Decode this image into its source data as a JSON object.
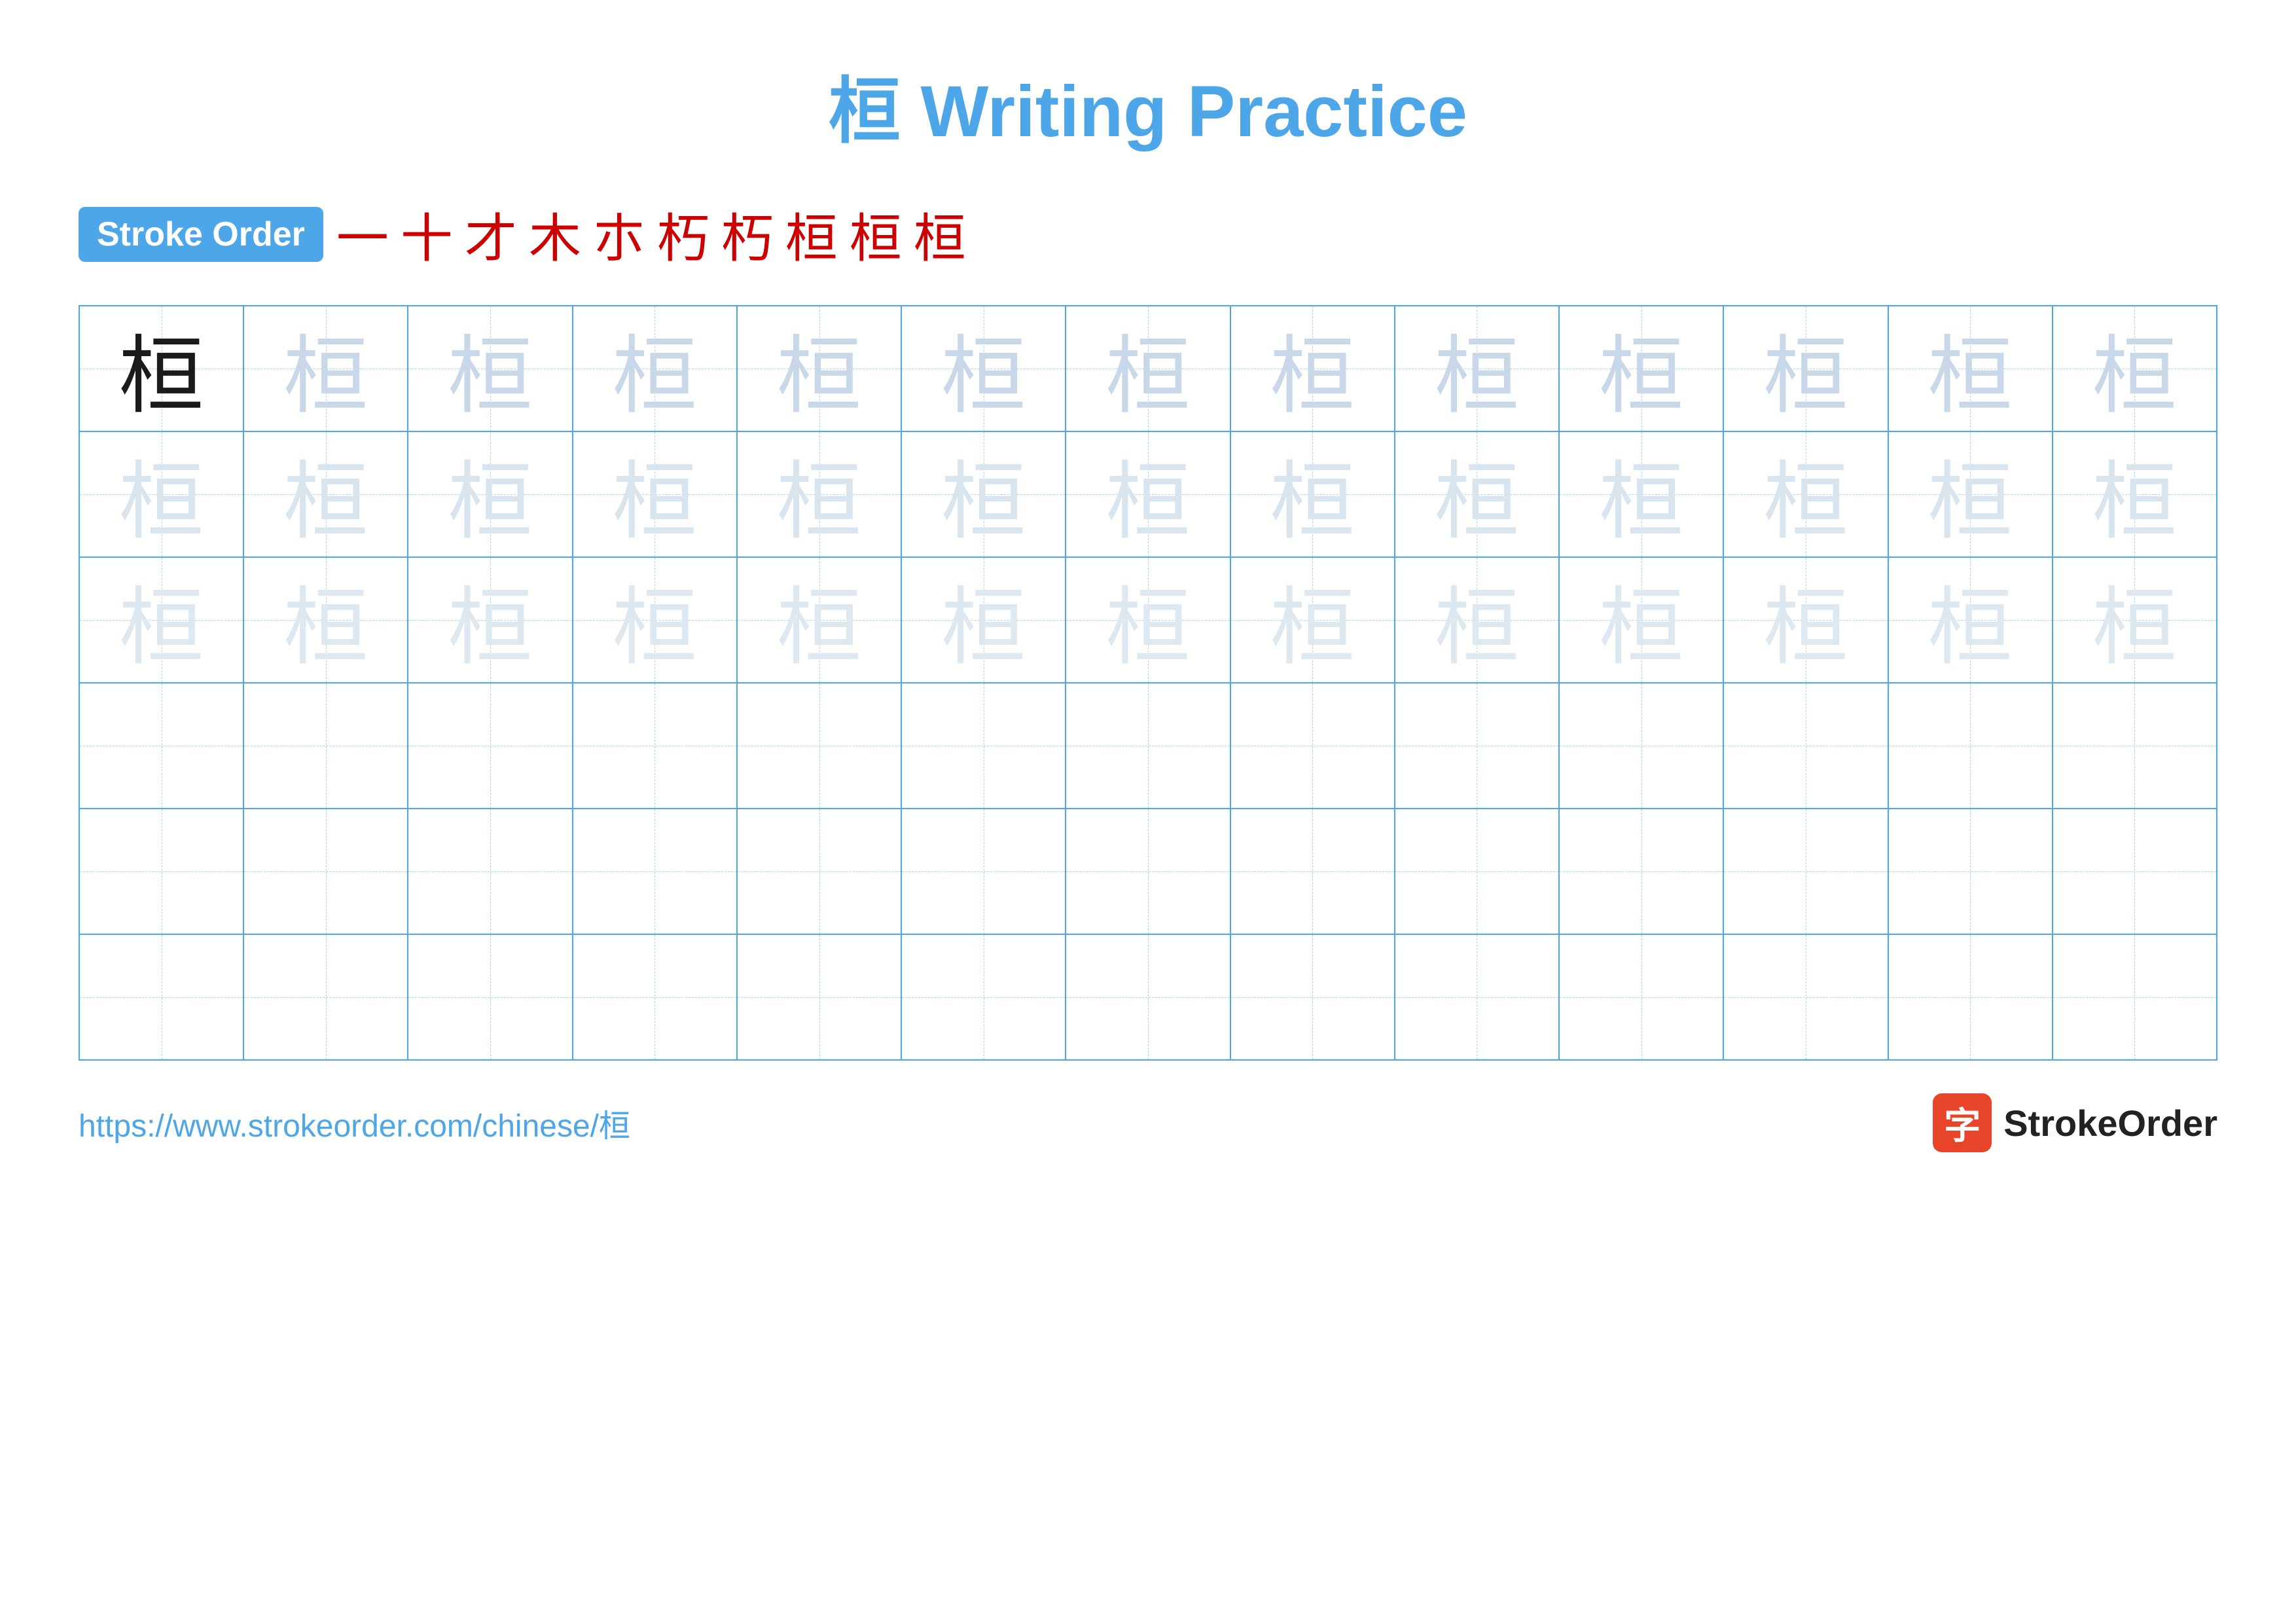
{
  "title": "桓 Writing Practice",
  "stroke_order": {
    "badge_label": "Stroke Order",
    "strokes": [
      "一",
      "十",
      "才",
      "木",
      "朩",
      "朽",
      "朽",
      "桓",
      "桓",
      "桓"
    ]
  },
  "character": "桓",
  "grid": {
    "rows": 6,
    "cols": 13
  },
  "footer": {
    "url": "https://www.strokeorder.com/chinese/桓",
    "logo_char": "字",
    "logo_text": "StrokeOrder"
  },
  "colors": {
    "accent": "#4da6e8",
    "stroke_red": "#cc0000",
    "char_dark": "#1a1a1a",
    "char_light1": "#b8ccd8",
    "char_light2": "#ccd8e4",
    "char_lighter": "#dde8f0"
  }
}
